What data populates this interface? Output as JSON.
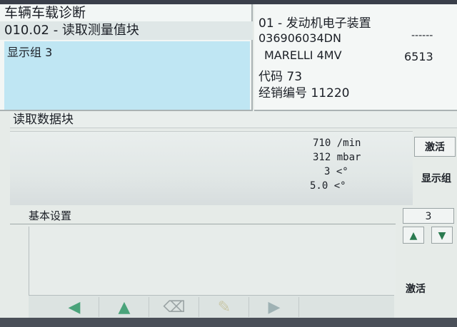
{
  "app": {
    "title": "车辆车载诊断"
  },
  "function": {
    "label": "010.02 - 读取测量值块"
  },
  "group_selector": {
    "label": "显示组 3"
  },
  "ecu": {
    "line1": "01 - 发动机电子装置",
    "part_number": "036906034DN",
    "dashes": "------",
    "system": "MARELLI 4MV",
    "software": "6513",
    "code": "代码 73",
    "dealer": "经销编号 11220"
  },
  "data_block": {
    "title": "读取数据块",
    "values": [
      "710 /min",
      "312 mbar",
      "3 <°",
      "5.0 <°"
    ]
  },
  "buttons": {
    "activate_top": "激活",
    "display_group": "显示组",
    "group_number": "3",
    "activate_bottom": "激活"
  },
  "basic_settings": {
    "title": "基本设置"
  },
  "nav_icons": [
    "arrow-left-icon",
    "arrow-up-icon",
    "eraser-icon",
    "marker-icon",
    "arrow-right-icon"
  ],
  "colors": {
    "selection": "#bfe6f3",
    "nav_arrow": "#4aa37a"
  }
}
